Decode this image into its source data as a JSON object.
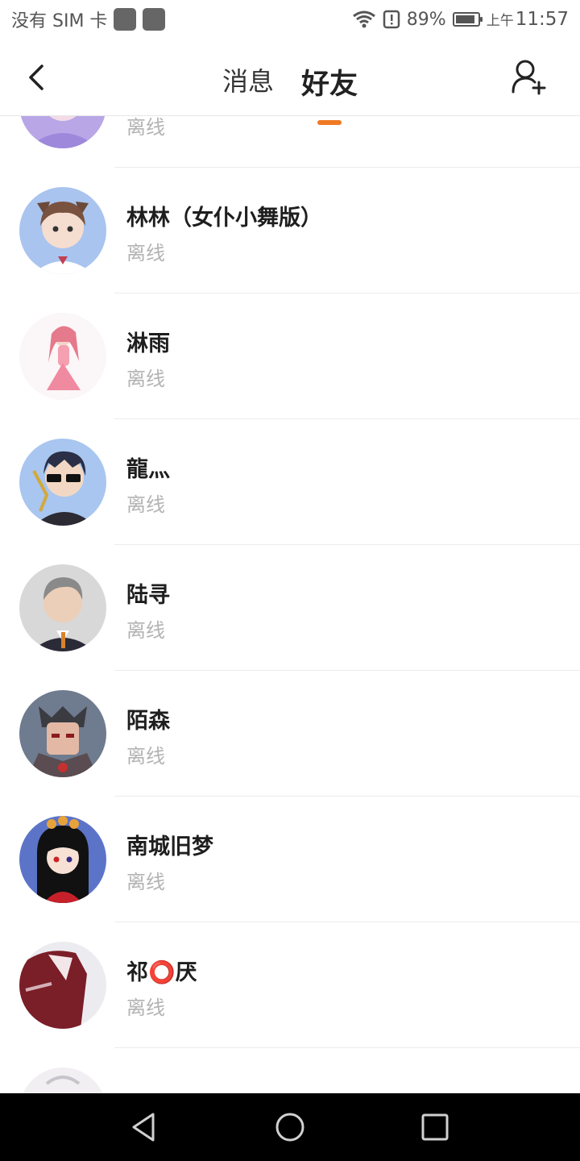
{
  "status_bar": {
    "carrier": "没有 SIM 卡",
    "battery_percent": "89%",
    "battery_level": 0.89,
    "ampm": "上午",
    "time": "11:57",
    "icons": [
      "notification-icon",
      "notification-icon",
      "wifi-icon",
      "alert-icon",
      "battery-icon"
    ]
  },
  "header": {
    "back_icon": "back-arrow-icon",
    "tabs": [
      {
        "label": "消息",
        "active": false
      },
      {
        "label": "好友",
        "active": true
      }
    ],
    "add_friend_icon": "add-person-icon",
    "accent_color": "#f07a24"
  },
  "friends": [
    {
      "name": "",
      "status": "离线"
    },
    {
      "name": "林林（女仆小舞版）",
      "status": "离线"
    },
    {
      "name": "淋雨",
      "status": "离线"
    },
    {
      "name": "龍灬",
      "status": "离线"
    },
    {
      "name": "陆寻",
      "status": "离线"
    },
    {
      "name": "陌森",
      "status": "离线"
    },
    {
      "name": "南城旧梦",
      "status": "离线"
    },
    {
      "name": "祁⭕厌",
      "status": "离线"
    },
    {
      "name": "",
      "status": ""
    }
  ],
  "nav_bar": {
    "icons": [
      "nav-back-icon",
      "nav-home-icon",
      "nav-recents-icon"
    ]
  }
}
